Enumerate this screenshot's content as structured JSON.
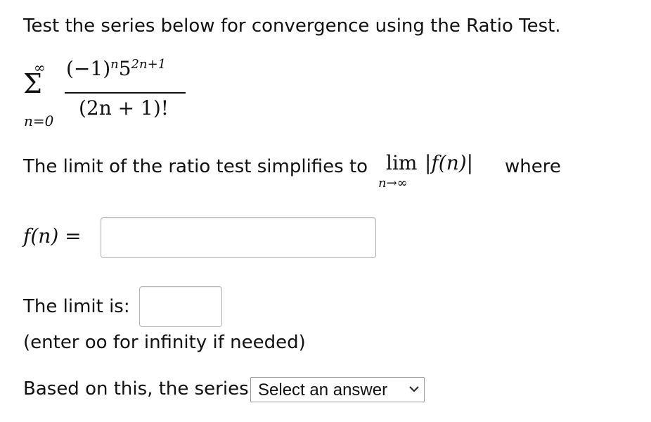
{
  "question": {
    "instruction": "Test the series below for convergence using the Ratio Test.",
    "series": {
      "sigma": "Σ",
      "upper": "∞",
      "lower": "n=0",
      "numerator_base": "(−1)",
      "numerator_exp1": "n",
      "numerator_mid": "5",
      "numerator_exp2": "2n+1",
      "denominator": "(2n + 1)!"
    },
    "limit_sentence": "The limit of the ratio test simplifies to",
    "lim_word": "lim",
    "lim_sub": "n→∞",
    "lim_abs": "|f(n)|",
    "where_word": "where",
    "fn_label": "f(n) =",
    "fn_value": "",
    "limit_label": "The limit is:",
    "limit_value": "",
    "hint": "(enter oo for infinity if needed)",
    "based_text": "Based on this, the series",
    "select_value": "Select an answer"
  }
}
